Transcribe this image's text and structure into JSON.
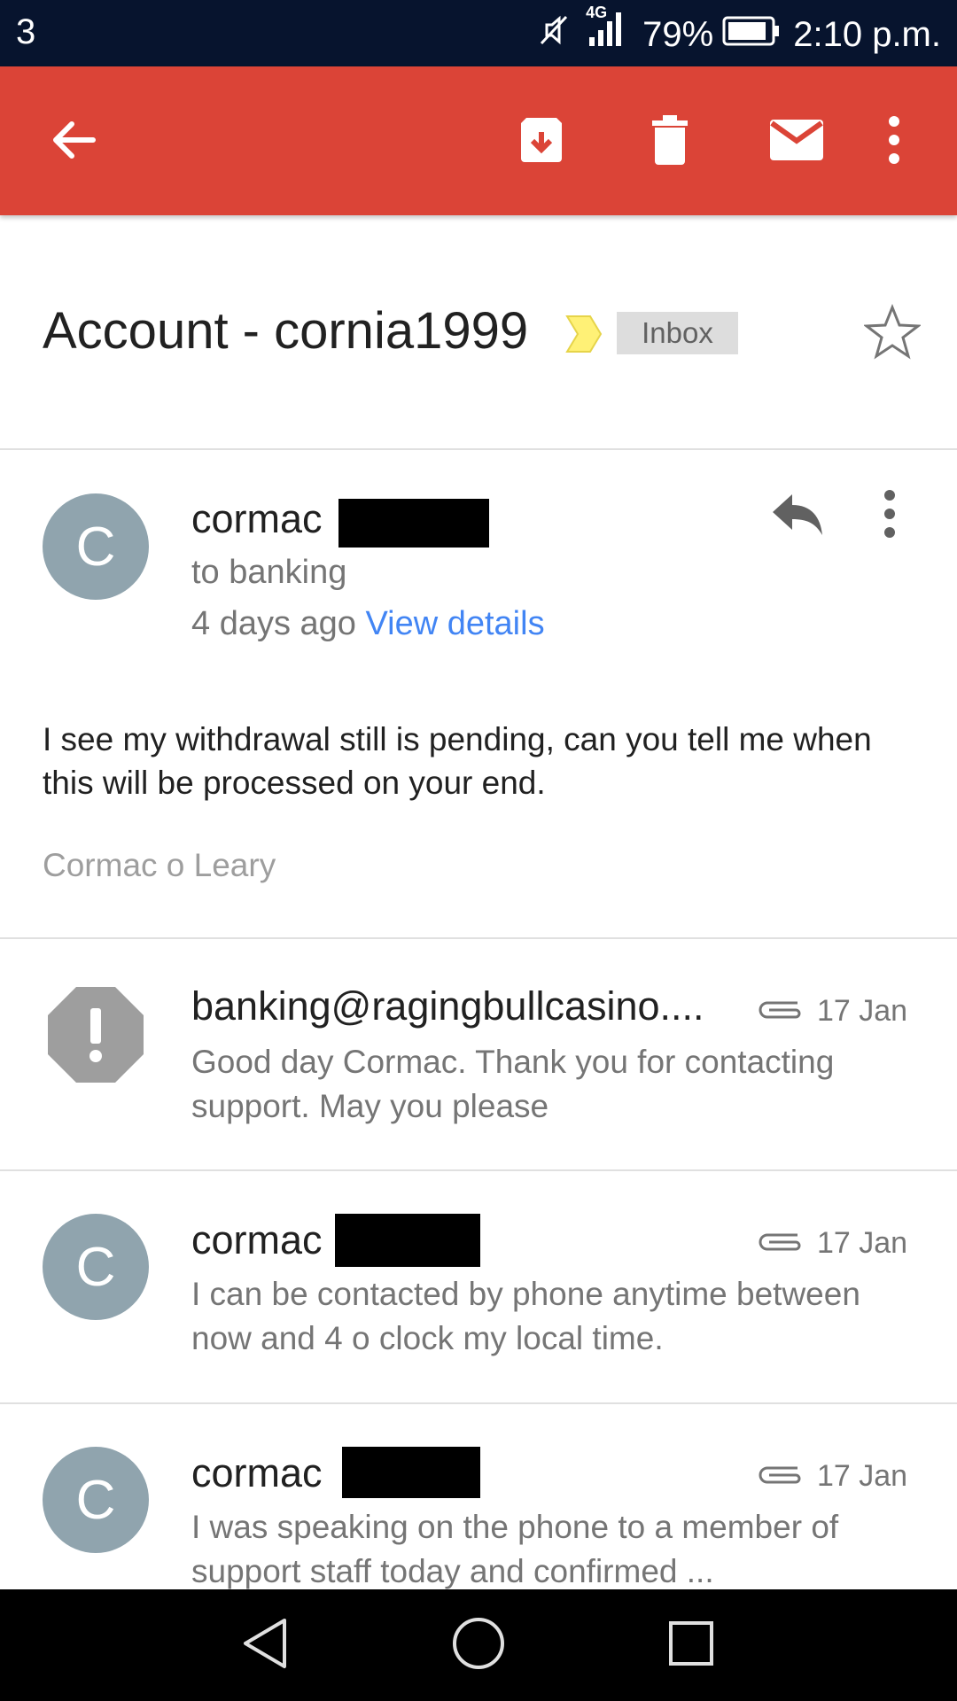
{
  "status_bar": {
    "carrier": "3",
    "network": "4G",
    "battery": "79%",
    "time": "2:10 p.m.",
    "icons": [
      "mute-icon",
      "signal-icon",
      "battery-icon"
    ]
  },
  "app_bar": {
    "color": "#db4437",
    "actions": [
      "back-arrow-icon",
      "archive-icon",
      "delete-icon",
      "mark-unread-icon",
      "more-vert-icon"
    ]
  },
  "subject": {
    "title": "Account - cornia1999",
    "label": "Inbox",
    "importance_color": "#fff176"
  },
  "expanded_message": {
    "avatar_letter": "C",
    "sender": "cormac",
    "recipient": "to banking",
    "time": "4 days ago",
    "details_link": "View details",
    "body": "I see my withdrawal still is pending, can you tell me when this will be processed on your end.",
    "signature": "Cormac o Leary"
  },
  "thread": [
    {
      "sender": "banking@ragingbullcasino....",
      "date": "17 Jan",
      "snippet": "Good day Cormac. Thank you for contacting support. May you please",
      "avatar": "warning-octagon-icon"
    },
    {
      "sender": "cormac",
      "date": "17 Jan",
      "snippet": "I can be contacted by phone anytime between now and 4 o clock my local time.",
      "avatar_letter": "C"
    },
    {
      "sender": "cormac",
      "date": "17 Jan",
      "snippet": "I was speaking on the phone to a member of support staff today and confirmed ...",
      "avatar_letter": "C"
    }
  ],
  "colors": {
    "status_bar": "#07142e",
    "avatar": "#90a4ae",
    "link": "#4285f4"
  }
}
